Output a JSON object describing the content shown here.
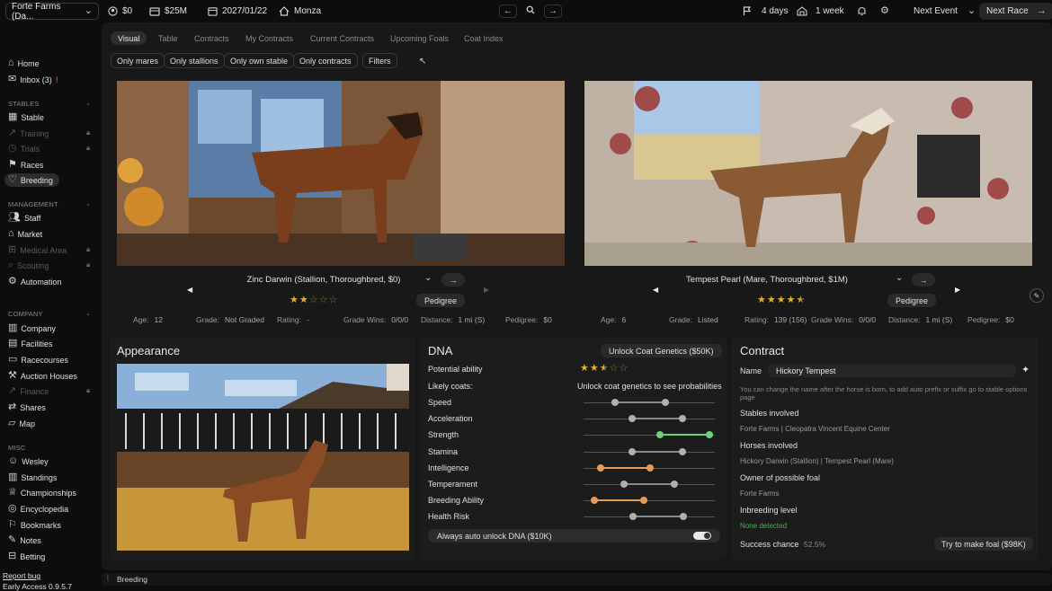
{
  "topbar": {
    "farm_name": "Forte Farms (Da...",
    "money": "$0",
    "value": "$25M",
    "date": "2027/01/22",
    "location": "Monza",
    "event_days": "4 days",
    "stable_time": "1 week",
    "next_event_label": "Next Event",
    "next_race_label": "Next Race"
  },
  "sidebar": {
    "home": "Home",
    "inbox": "Inbox (3)",
    "sec_stables": "STABLES",
    "stable": "Stable",
    "training": "Training",
    "trials": "Trials",
    "races": "Races",
    "breeding": "Breeding",
    "sec_management": "MANAGEMENT",
    "staff": "Staff",
    "market": "Market",
    "medical": "Medical Area",
    "scouting": "Scouting",
    "automation": "Automation",
    "sec_company": "COMPANY",
    "company": "Company",
    "facilities": "Facilities",
    "racecourses": "Racecourses",
    "auction": "Auction Houses",
    "finance": "Finance",
    "shares": "Shares",
    "map": "Map",
    "sec_misc": "MISC",
    "wesley": "Wesley",
    "standings": "Standings",
    "championships": "Championships",
    "encyclopedia": "Encyclopedia",
    "bookmarks": "Bookmarks",
    "notes": "Notes",
    "betting": "Betting",
    "report_bug": "Report bug",
    "version": "Early Access 0.9.5.7"
  },
  "tabs": [
    "Visual",
    "Table",
    "Contracts",
    "My Contracts",
    "Current Contracts",
    "Upcoming Foals",
    "Coat Index"
  ],
  "filters": [
    "Only mares",
    "Only stallions",
    "Only own stable",
    "Only contracts",
    "Filters"
  ],
  "sire": {
    "name": "Zinc Darwin (Stallion, Thoroughbred, $0)",
    "stars": 2,
    "pedigree_label": "Pedigree",
    "age_label": "Age:",
    "age": "12",
    "grade_label": "Grade:",
    "grade": "Not Graded",
    "rating_label": "Rating:",
    "rating": "-",
    "gradewins_label": "Grade Wins:",
    "gradewins": "0/0/0",
    "distance_label": "Distance:",
    "distance": "1 mi (S)",
    "pedigree_val_label": "Pedigree:",
    "pedigree_val": "$0"
  },
  "dam": {
    "name": "Tempest Pearl (Mare, Thoroughbred, $1M)",
    "stars": 4.5,
    "pedigree_label": "Pedigree",
    "age_label": "Age:",
    "age": "6",
    "grade_label": "Grade:",
    "grade": "Listed",
    "rating_label": "Rating:",
    "rating": "139 (156)",
    "gradewins_label": "Grade Wins:",
    "gradewins": "0/0/0",
    "distance_label": "Distance:",
    "distance": "1 mi (S)",
    "pedigree_val_label": "Pedigree:",
    "pedigree_val": "$0"
  },
  "appearance": {
    "title": "Appearance"
  },
  "dna": {
    "title": "DNA",
    "unlock_label": "Unlock Coat Genetics ($50K)",
    "potential_label": "Potential ability",
    "potential_stars": 2.5,
    "coats_label": "Likely coats:",
    "coats_value": "Unlock coat genetics to see probabilities",
    "traits": [
      {
        "name": "Speed",
        "lo": 0.24,
        "hi": 0.62,
        "color": "#8a8a8a"
      },
      {
        "name": "Acceleration",
        "lo": 0.37,
        "hi": 0.75,
        "color": "#8a8a8a"
      },
      {
        "name": "Strength",
        "lo": 0.58,
        "hi": 0.96,
        "color": "#6fd07a"
      },
      {
        "name": "Stamina",
        "lo": 0.37,
        "hi": 0.75,
        "color": "#8a8a8a"
      },
      {
        "name": "Intelligence",
        "lo": 0.13,
        "hi": 0.51,
        "color": "#e89a5a"
      },
      {
        "name": "Temperament",
        "lo": 0.31,
        "hi": 0.69,
        "color": "#8a8a8a"
      },
      {
        "name": "Breeding Ability",
        "lo": 0.08,
        "hi": 0.46,
        "color": "#e89a5a"
      },
      {
        "name": "Health Risk",
        "lo": 0.38,
        "hi": 0.76,
        "color": "#8a8a8a"
      }
    ],
    "auto_unlock_label": "Always auto unlock DNA ($10K)"
  },
  "contract": {
    "title": "Contract",
    "name_label": "Name",
    "name_value": "Hickory Tempest",
    "hint": "You can change the name after the horse is born, to add auto prefix or suffix go to stable options page",
    "stables_label": "Stables involved",
    "stables_value": "Forte Farms | Cleopatra Vincent Equine Center",
    "horses_label": "Horses involved",
    "horses_value": "Hickory Darwin (Stallion) | Tempest Pearl (Mare)",
    "owner_label": "Owner of possible foal",
    "owner_value": "Forte Farms",
    "inbreeding_label": "Inbreeding level",
    "inbreeding_value": "None detected",
    "success_label": "Success chance",
    "success_value": "52.5%",
    "try_label": "Try to make foal ($98K)"
  },
  "statusbar": {
    "crumb": "Breeding"
  },
  "colors": {
    "accent_green": "#6fd07a",
    "accent_orange": "#e89a5a",
    "star": "#e3b12b",
    "inbox_alert": "#e03a3a"
  }
}
